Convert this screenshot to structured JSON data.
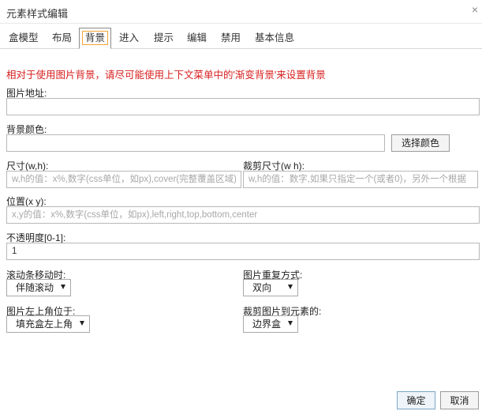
{
  "dialog": {
    "title": "元素样式编辑",
    "close_glyph": "×"
  },
  "tabs": [
    {
      "label": "盒模型"
    },
    {
      "label": "布局"
    },
    {
      "label": "背景",
      "active": true
    },
    {
      "label": "进入"
    },
    {
      "label": "提示"
    },
    {
      "label": "编辑"
    },
    {
      "label": "禁用"
    },
    {
      "label": "基本信息"
    }
  ],
  "background": {
    "warning": "相对于使用图片背景，请尽可能使用上下文菜单中的'渐变背景'来设置背景",
    "image_url": {
      "label": "图片地址:",
      "value": ""
    },
    "color": {
      "label": "背景颜色:",
      "value": "",
      "button": "选择颜色"
    },
    "size": {
      "label_cn": "尺寸",
      "label_en": "(w,h):",
      "value": "",
      "placeholder": "w,h的值：x%,数字(css单位，如px),cover(完整覆盖区域)"
    },
    "clip_size": {
      "label_cn": "裁剪尺寸",
      "label_en": "(w h):",
      "value": "",
      "placeholder": "w,h的值：数字,如果只指定一个(或者0)，另外一个根据"
    },
    "position": {
      "label_cn": "位置",
      "label_en": "(x y):",
      "value": "",
      "placeholder": "x,y的值：x%,数字(css单位，如px),left,right,top,bottom,center"
    },
    "opacity": {
      "label": "不透明度[0-1]:",
      "value": "1"
    },
    "attachment": {
      "label": "滚动条移动时:",
      "selected": "伴随滚动"
    },
    "repeat": {
      "label": "图片重复方式:",
      "selected": "双向"
    },
    "origin": {
      "label": "图片左上角位于:",
      "selected": "填充盒左上角"
    },
    "clip": {
      "label": "裁剪图片到元素的:",
      "selected": "边界盒"
    }
  },
  "footer": {
    "ok": "确定",
    "cancel": "取消"
  },
  "colors": {
    "warning": "#d81e1e",
    "active_tab_highlight": "#f3a53b",
    "border": "#b8b8b8"
  }
}
